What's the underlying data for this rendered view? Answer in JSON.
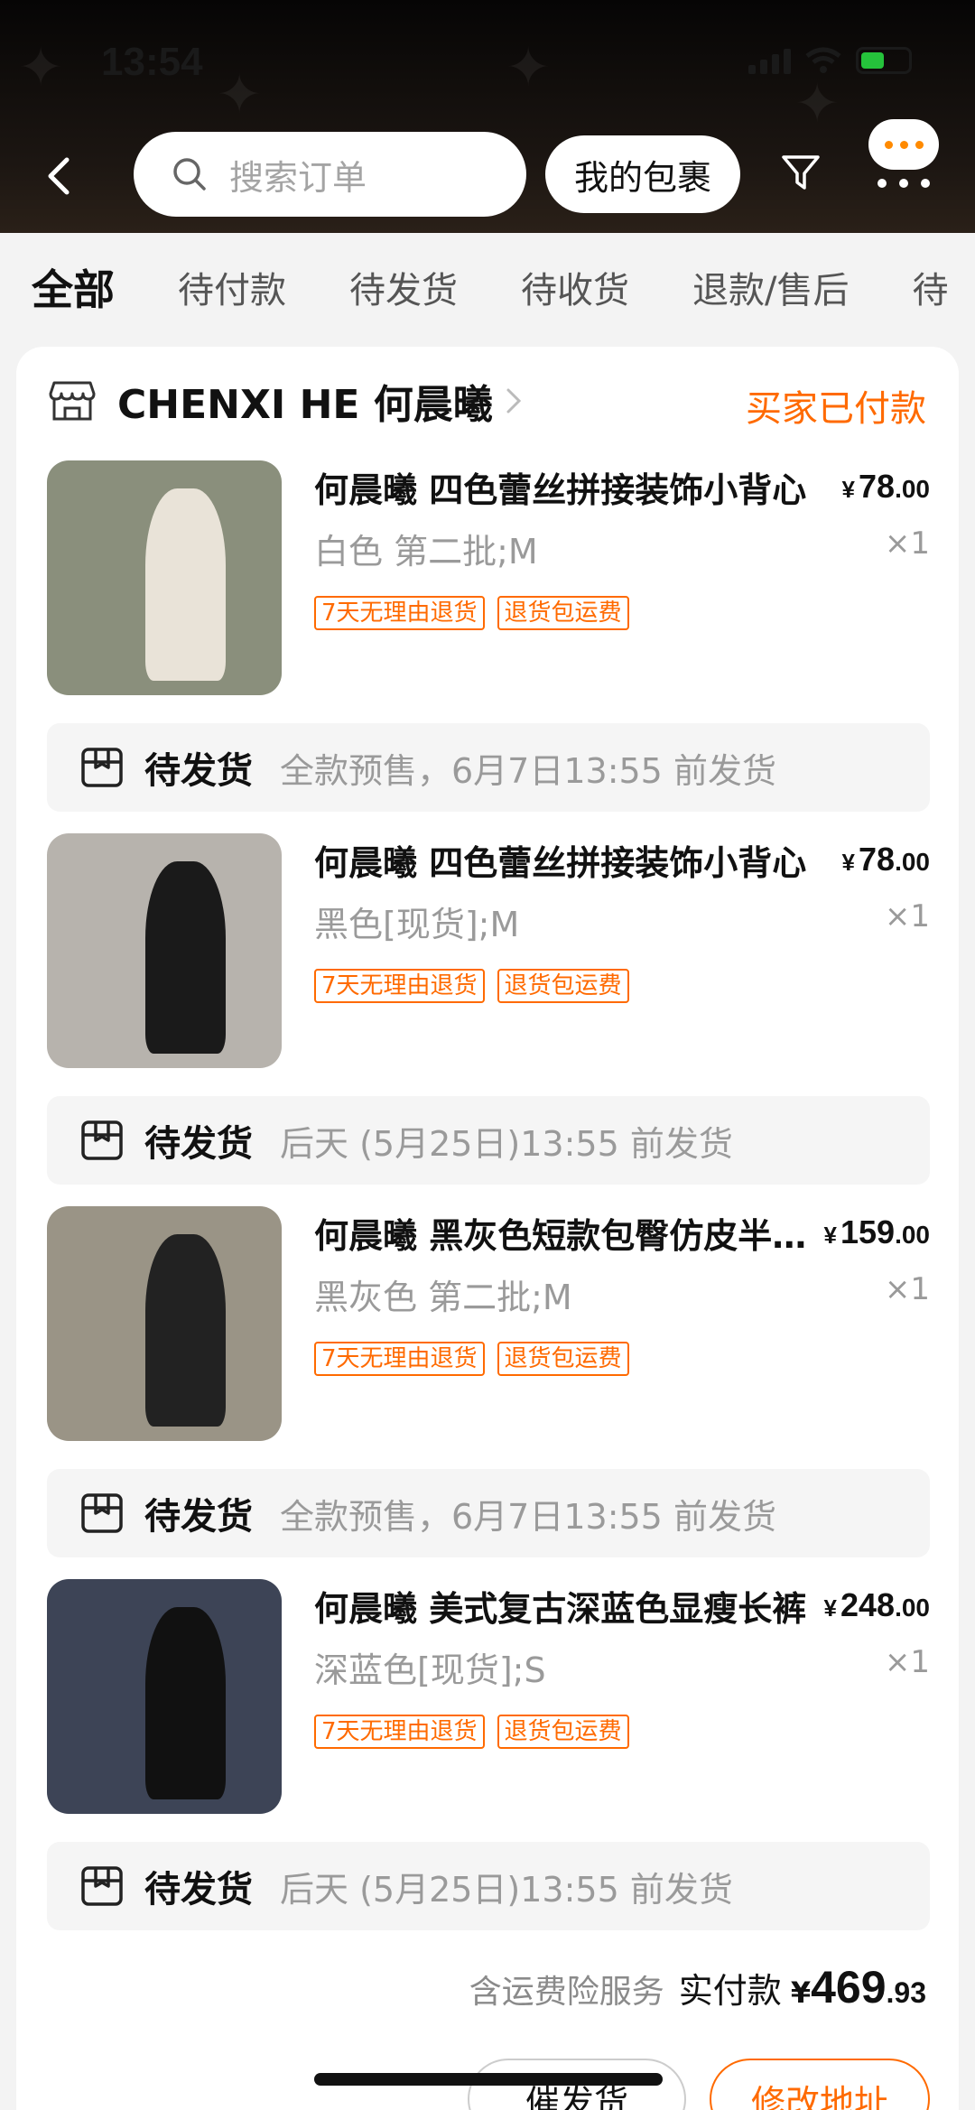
{
  "status_bar": {
    "time": "13:54"
  },
  "header": {
    "search_placeholder": "搜索订单",
    "my_packages": "我的包裹",
    "back_icon": "chevron-left-icon",
    "filter_icon": "filter-icon",
    "more_icon": "more-icon"
  },
  "tabs": [
    "全部",
    "待付款",
    "待发货",
    "待收货",
    "退款/售后",
    "待"
  ],
  "order": {
    "shop_name": "CHENXI HE 何晨曦",
    "status": "买家已付款",
    "items": [
      {
        "title": "何晨曦 四色蕾丝拼接装饰小背心",
        "spec": "白色 第二批;M",
        "price_yen": "¥",
        "price_int": "78",
        "price_dec": ".00",
        "qty": "×1",
        "tags": [
          "7天无理由退货",
          "退货包运费"
        ],
        "ship_label": "待发货",
        "ship_desc": "全款预售，6月7日13:55 前发货",
        "img_bg": "#8a8f7c",
        "img_fig": "#e9e3d8"
      },
      {
        "title": "何晨曦 四色蕾丝拼接装饰小背心",
        "spec": "黑色[现货];M",
        "price_yen": "¥",
        "price_int": "78",
        "price_dec": ".00",
        "qty": "×1",
        "tags": [
          "7天无理由退货",
          "退货包运费"
        ],
        "ship_label": "待发货",
        "ship_desc": "后天 (5月25日)13:55 前发货",
        "img_bg": "#b7b3ad",
        "img_fig": "#1a1a1a"
      },
      {
        "title": "何晨曦 黑灰色短款包臀仿皮半身裙",
        "spec": "黑灰色 第二批;M",
        "price_yen": "¥",
        "price_int": "159",
        "price_dec": ".00",
        "qty": "×1",
        "tags": [
          "7天无理由退货",
          "退货包运费"
        ],
        "ship_label": "待发货",
        "ship_desc": "全款预售，6月7日13:55 前发货",
        "img_bg": "#9a9486",
        "img_fig": "#222222"
      },
      {
        "title": "何晨曦 美式复古深蓝色显瘦长裤",
        "spec": "深蓝色[现货];S",
        "price_yen": "¥",
        "price_int": "248",
        "price_dec": ".00",
        "qty": "×1",
        "tags": [
          "7天无理由退货",
          "退货包运费"
        ],
        "ship_label": "待发货",
        "ship_desc": "后天 (5月25日)13:55 前发货",
        "img_bg": "#3d4456",
        "img_fig": "#111111"
      }
    ],
    "insurance": "含运费险服务",
    "paid_label": "实付款",
    "total_yen": "¥",
    "total_int": "469",
    "total_dec": ".93",
    "btn_remind": "催发货",
    "btn_address": "修改地址"
  },
  "colors": {
    "accent": "#ff6a00",
    "header_dark": "#1c1612"
  }
}
